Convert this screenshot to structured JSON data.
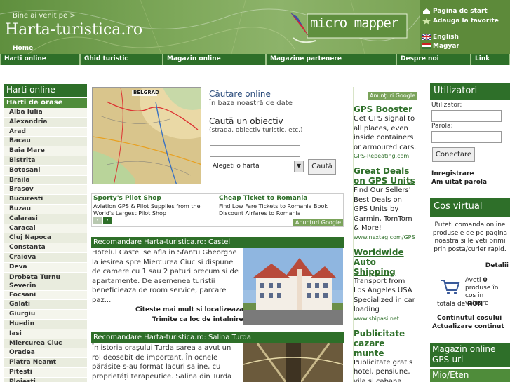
{
  "header": {
    "welcome": "Bine ai venit pe >",
    "site_name": "Harta-turistica.ro",
    "home": "Home",
    "logo_text": "micro mapper",
    "links": [
      {
        "label": "Pagina de start",
        "icon": "home-icon"
      },
      {
        "label": "Adauga la favorite",
        "icon": "star-icon"
      },
      {
        "label": "English",
        "icon": "uk-flag-icon"
      },
      {
        "label": "Magyar",
        "icon": "hu-flag-icon"
      }
    ]
  },
  "nav": {
    "items": [
      "Harti online",
      "Ghid turistic",
      "Magazin online",
      "Magazine partenere",
      "Despre noi",
      "Link"
    ]
  },
  "left": {
    "title": "Harti online",
    "subtitle": "Harti de orase",
    "cities": [
      "Alba Iulia",
      "Alexandria",
      "Arad",
      "Bacau",
      "Baia Mare",
      "Bistrita",
      "Botosani",
      "Braila",
      "Brasov",
      "Bucuresti",
      "Buzau",
      "Calarasi",
      "Caracal",
      "Cluj Napoca",
      "Constanta",
      "Craiova",
      "Deva",
      "Drobeta Turnu Severin",
      "Focsani",
      "Galati",
      "Giurgiu",
      "Huedin",
      "Iasi",
      "Miercurea Ciuc",
      "Oradea",
      "Piatra Neamt",
      "Pitesti",
      "Ploiesti"
    ]
  },
  "search": {
    "title": "Căutare online",
    "subtitle": "În baza noastră de date",
    "obj_title": "Caută un obiectiv",
    "obj_sub": "(strada, obiectiv turistic, etc.)",
    "input_value": "",
    "select_value": "Alegeti o hartă",
    "button": "Caută",
    "map_label": "BELGRAD"
  },
  "ads": {
    "items": [
      {
        "title": "Sporty's Pilot Shop",
        "text": "Aviation GPS & Pilot Supplies from the World's Largest Pilot Shop"
      },
      {
        "title": "Cheap Ticket to Romania",
        "text": "Find Low Fare Tickets to Romania Book Discount Airfares to Romania"
      }
    ],
    "google_tag": "Anunţuri Google",
    "prev": "‹",
    "next": "›"
  },
  "rec1": {
    "title": "Recomandare Harta-turistica.ro: Castel",
    "text": "Hotelul Castel se afla in Sfantu Gheorghe la iesirea spre Miercurea Ciuc si dispune de camere cu 1 sau 2 paturi precum si de apartamente. De asemenea turistii beneficieaza de room service, parcare paz...",
    "link1": "Citeste mai mult si localizeaza",
    "link2": "Trimite ca loc de intalnire"
  },
  "rec2": {
    "title": "Recomandare Harta-turistica.ro: Salina Turda",
    "text": "În istoria oraşului Turda sarea a avut un rol deosebit de important. În ocnele părăsite s-au format lacuri saline, cu proprietăţi terapeutice. Salina din Turda merită vizitată. Exploatarea de sare a ..."
  },
  "google_col": {
    "tag": "Anunţuri Google",
    "ads": [
      {
        "title": "GPS Booster",
        "text": "Get GPS signal to all places, even inside containers or armoured cars.",
        "url": "GPS-Repeating.com"
      },
      {
        "title": "Great Deals on GPS Units",
        "text": "Find Our Sellers' Best Deals on GPS Units by Garmin, TomTom & More!",
        "url": "www.nextag.com/GPS"
      },
      {
        "title": "Worldwide Auto Shipping",
        "text": "Transport from Los Angeles USA Specialized in car loading",
        "url": "www.shipasi.net"
      },
      {
        "title": "Publicitate cazare munte",
        "text": "Publicitate gratis hotel, pensiune, vila si cabana",
        "url": ""
      }
    ]
  },
  "users": {
    "title": "Utilizatori",
    "user_label": "Utilizator:",
    "pass_label": "Parola:",
    "login": "Conectare",
    "register": "Inregistrare",
    "forgot": "Am uitat parola"
  },
  "cart": {
    "title": "Cos virtual",
    "text": "Puteti comanda online produsele de pe pagina noastra si le veti primi prin posta/curier rapid.",
    "details": "Detalii",
    "have": "Aveti",
    "count": "0",
    "products_text": "produse în cos in valoare",
    "total_label": "totală de",
    "currency": "RON",
    "continue": "Continutul cosului",
    "update": "Actualizare continut"
  },
  "shop": {
    "title": "Magazin online GPS-uri",
    "next_title": "Mio/Eten"
  },
  "colors": {
    "primary": "#2e6f29",
    "accent": "#4f8c3a",
    "light": "#e9ecde"
  }
}
